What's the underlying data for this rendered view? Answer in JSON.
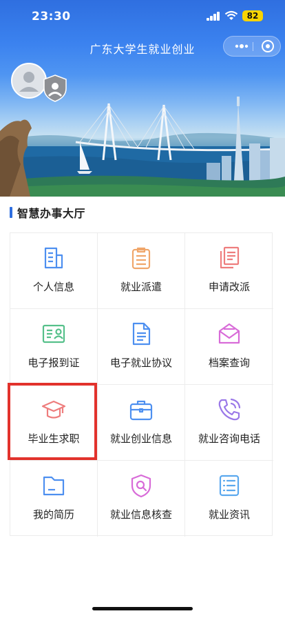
{
  "status_bar": {
    "time": "23:30",
    "battery": "82"
  },
  "nav": {
    "title": "广东大学生就业创业"
  },
  "section": {
    "title": "智慧办事大厅"
  },
  "services": [
    {
      "label": "个人信息",
      "icon": "document-list-icon",
      "color": "#4d8ff0"
    },
    {
      "label": "就业派遣",
      "icon": "clipboard-icon",
      "color": "#f0a66a"
    },
    {
      "label": "申请改派",
      "icon": "copy-document-icon",
      "color": "#ee7d7d"
    },
    {
      "label": "电子报到证",
      "icon": "id-card-icon",
      "color": "#55c08a"
    },
    {
      "label": "电子就业协议",
      "icon": "file-text-icon",
      "color": "#4d8ff0"
    },
    {
      "label": "档案查询",
      "icon": "envelope-icon",
      "color": "#d86bd8"
    },
    {
      "label": "毕业生求职",
      "icon": "graduation-cap-icon",
      "color": "#ee7d7d"
    },
    {
      "label": "就业创业信息",
      "icon": "briefcase-icon",
      "color": "#4d8ff0"
    },
    {
      "label": "就业咨询电话",
      "icon": "phone-call-icon",
      "color": "#9a78e8"
    },
    {
      "label": "我的简历",
      "icon": "folder-icon",
      "color": "#4d8ff0"
    },
    {
      "label": "就业信息核查",
      "icon": "shield-search-icon",
      "color": "#d86bd8"
    },
    {
      "label": "就业资讯",
      "icon": "news-list-icon",
      "color": "#5aa8ee"
    }
  ],
  "highlighted_item": "毕业生求职"
}
